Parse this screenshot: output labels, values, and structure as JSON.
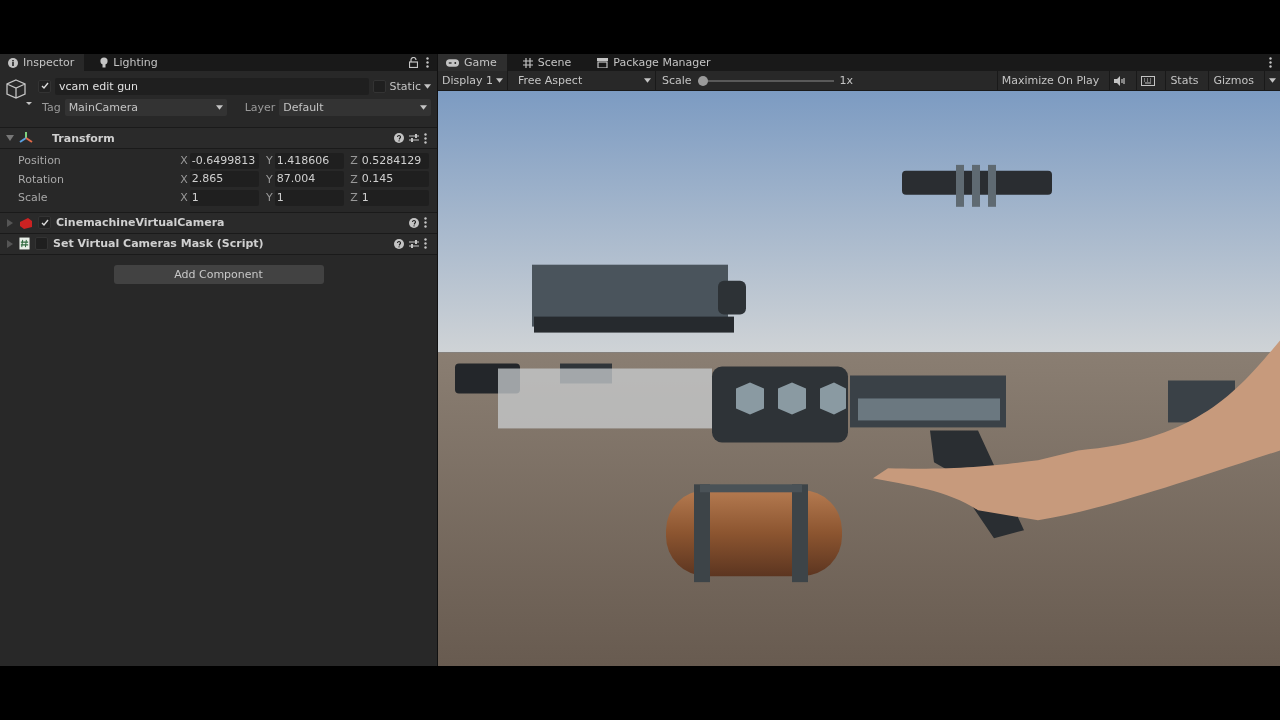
{
  "inspector_tabs": [
    {
      "label": "Inspector",
      "kind": "info",
      "selected": true
    },
    {
      "label": "Lighting",
      "kind": "bulb",
      "selected": false
    }
  ],
  "game_object": {
    "active": true,
    "name": "vcam edit gun",
    "static": false,
    "static_label": "Static",
    "tag_label": "Tag",
    "tag": "MainCamera",
    "layer_label": "Layer",
    "layer": "Default"
  },
  "components": [
    {
      "kind": "transform",
      "title": "Transform",
      "expanded": true,
      "rows": [
        {
          "label": "Position",
          "values": [
            {
              "axis": "X",
              "value": "-0.6499813"
            },
            {
              "axis": "Y",
              "value": "1.418606"
            },
            {
              "axis": "Z",
              "value": "0.5284129"
            }
          ]
        },
        {
          "label": "Rotation",
          "values": [
            {
              "axis": "X",
              "value": "2.865"
            },
            {
              "axis": "Y",
              "value": "87.004"
            },
            {
              "axis": "Z",
              "value": "0.145"
            }
          ]
        },
        {
          "label": "Scale",
          "values": [
            {
              "axis": "X",
              "value": "1"
            },
            {
              "axis": "Y",
              "value": "1"
            },
            {
              "axis": "Z",
              "value": "1"
            }
          ]
        }
      ]
    },
    {
      "kind": "cinemachine",
      "title": "CinemachineVirtualCamera",
      "expanded": false,
      "enabled": true
    },
    {
      "kind": "script",
      "title": "Set Virtual Cameras Mask (Script)",
      "expanded": false,
      "enabled": false
    }
  ],
  "add_component": "Add Component",
  "view_tabs": [
    {
      "label": "Game",
      "kind": "game",
      "selected": true
    },
    {
      "label": "Scene",
      "kind": "scene",
      "selected": false
    },
    {
      "label": "Package Manager",
      "kind": "package",
      "selected": false
    }
  ],
  "game_toolbar": {
    "display": "Display 1",
    "aspect": "Free Aspect",
    "scale_label": "Scale",
    "scale": {
      "level": 0
    },
    "scale_reading": "1x",
    "maximize_on_play": "Maximize On Play",
    "stats": "Stats",
    "gizmos": "Gizmos"
  }
}
